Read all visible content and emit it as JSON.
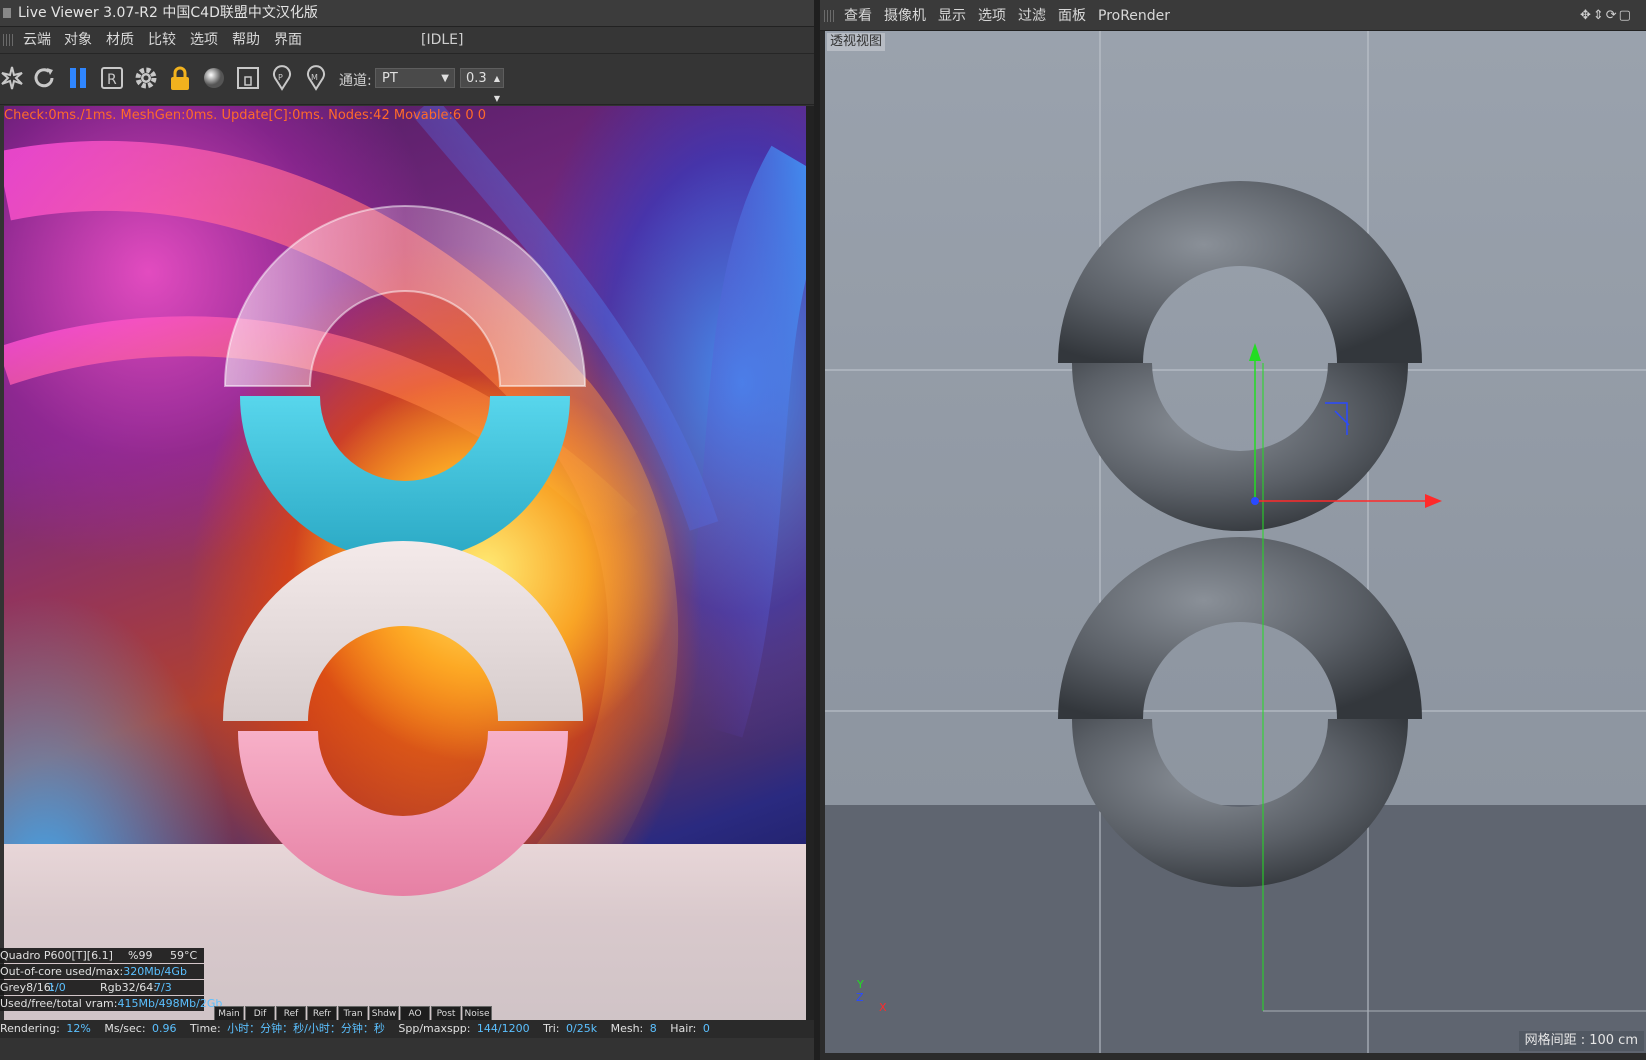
{
  "left": {
    "title": "Live Viewer 3.07-R2 中国C4D联盟中文汉化版",
    "menu": [
      "云端",
      "对象",
      "材质",
      "比较",
      "选项",
      "帮助",
      "界面"
    ],
    "status_tag": "[IDLE]",
    "toolbar": {
      "icons": [
        "spark-icon",
        "refresh-icon",
        "pause-icon",
        "r-icon",
        "gear-icon",
        "lock-icon",
        "sphere-icon",
        "region-icon",
        "pin-p-icon",
        "pin-m-icon"
      ],
      "channel_label": "通道:",
      "channel_value": "PT",
      "spin_value": "0.3",
      "lock_color": "#f2b21e",
      "pause_color": "#2f86ff"
    },
    "overlay_text": "Check:0ms./1ms. MeshGen:0ms. Update[C]:0ms. Nodes:42 Movable:6  0 0",
    "stats": {
      "gpu": "Quadro P600[T][6.1]",
      "gpu_pct": "%99",
      "gpu_temp": "59°C",
      "ooc_label": "Out-of-core used/max:",
      "ooc_value": "320Mb/4Gb",
      "grey_label": "Grey8/16:",
      "grey_value": "1/0",
      "rgb_label": "Rgb32/64:",
      "rgb_value": "7/3",
      "vram_label": "Used/free/total vram:",
      "vram_value": "415Mb/498Mb/2Gb"
    },
    "render_tabs": [
      "Main",
      "Dif",
      "Ref",
      "Refr",
      "Tran",
      "Shdw",
      "AO",
      "Post",
      "Noise"
    ],
    "statusbar": {
      "rendering_label": "Rendering:",
      "rendering_value": "12%",
      "ms_label": "Ms/sec:",
      "ms_value": "0.96",
      "time_label": "Time:",
      "time_value": "小时：分钟：秒/小时：分钟：秒",
      "spp_label": "Spp/maxspp:",
      "spp_value": "144/1200",
      "tri_label": "Tri:",
      "tri_value": "0/25k",
      "mesh_label": "Mesh:",
      "mesh_value": "8",
      "hair_label": "Hair:",
      "hair_value": "0"
    },
    "colors": {
      "cyan_ring": "#3fc4dc",
      "pink_ring": "#f29ab8",
      "frost_ring": "#e8dede"
    }
  },
  "right": {
    "menu": [
      "查看",
      "摄像机",
      "显示",
      "选项",
      "过滤",
      "面板",
      "ProRender"
    ],
    "viewport_label": "透视视图",
    "grid_info": "网格间距 : 100 cm",
    "axis": {
      "y": "Y",
      "z": "Z",
      "x": "X"
    },
    "colors": {
      "axis_x": "#ff2a2a",
      "axis_y": "#22dd22",
      "axis_z": "#2a4aff",
      "torus": "#5a5f66"
    }
  }
}
